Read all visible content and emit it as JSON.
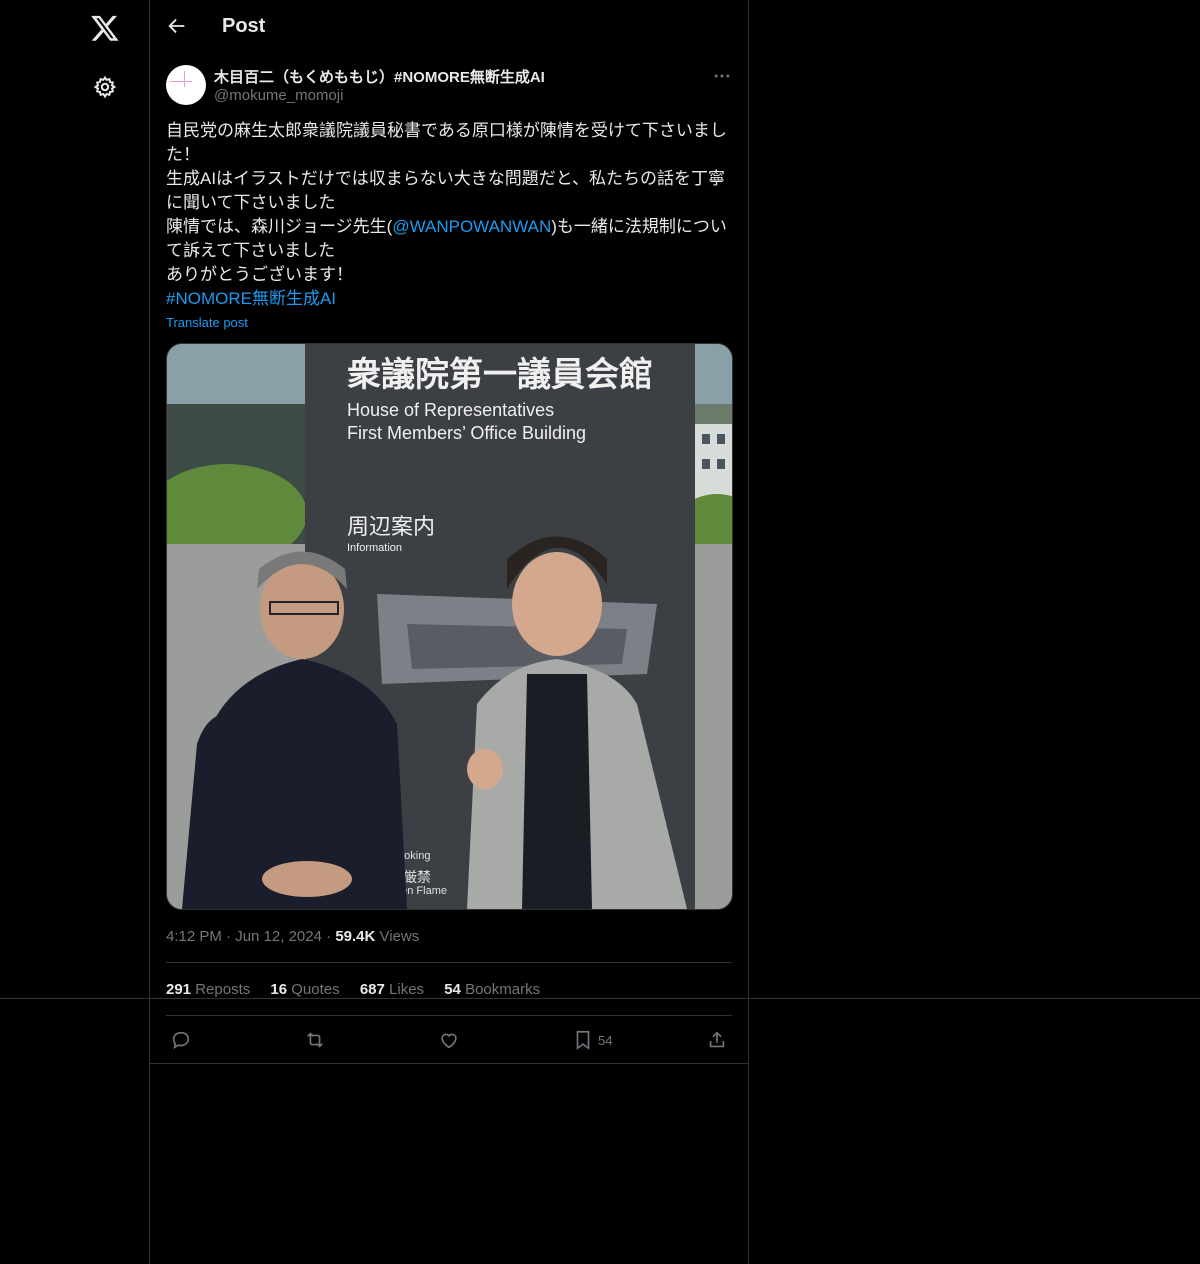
{
  "header": {
    "title": "Post"
  },
  "author": {
    "display_name": "木目百二（もくめももじ）#NOMORE無断生成AI",
    "handle": "@mokume_momoji"
  },
  "post": {
    "line1": "自民党の麻生太郎衆議院議員秘書である原口様が陳情を受けて下さいました！",
    "line2": "生成AIはイラストだけでは収まらない大きな問題だと、私たちの話を丁寧に聞いて下さいました",
    "line3_before": "陳情では、森川ジョージ先生(",
    "line3_mention": "@WANPOWANWAN",
    "line3_after": ")も一緒に法規制について訴えて下さいました",
    "line4": "ありがとうございます！",
    "hashtag": "#NOMORE無断生成AI",
    "translate": "Translate post"
  },
  "image": {
    "sign_jp": "衆議院第一議員会館",
    "sign_en1": "House of Representatives",
    "sign_en2": "First Members’ Office Building",
    "info_jp": "周辺案内",
    "info_en": "Information",
    "smoking": "moking",
    "fire_jp": "気厳禁",
    "fire_en": "pen Flame"
  },
  "meta": {
    "time": "4:12 PM",
    "date": "Jun 12, 2024",
    "views_count": "59.4K",
    "views_label": "Views"
  },
  "stats": {
    "reposts_count": "291",
    "reposts_label": "Reposts",
    "quotes_count": "16",
    "quotes_label": "Quotes",
    "likes_count": "687",
    "likes_label": "Likes",
    "bookmarks_count": "54",
    "bookmarks_label": "Bookmarks"
  },
  "actions": {
    "bookmark_count": "54"
  },
  "icons": [
    "x-logo-icon",
    "gear-icon",
    "back-arrow-icon",
    "more-icon",
    "reply-icon",
    "repost-icon",
    "like-icon",
    "bookmark-icon",
    "share-icon"
  ]
}
